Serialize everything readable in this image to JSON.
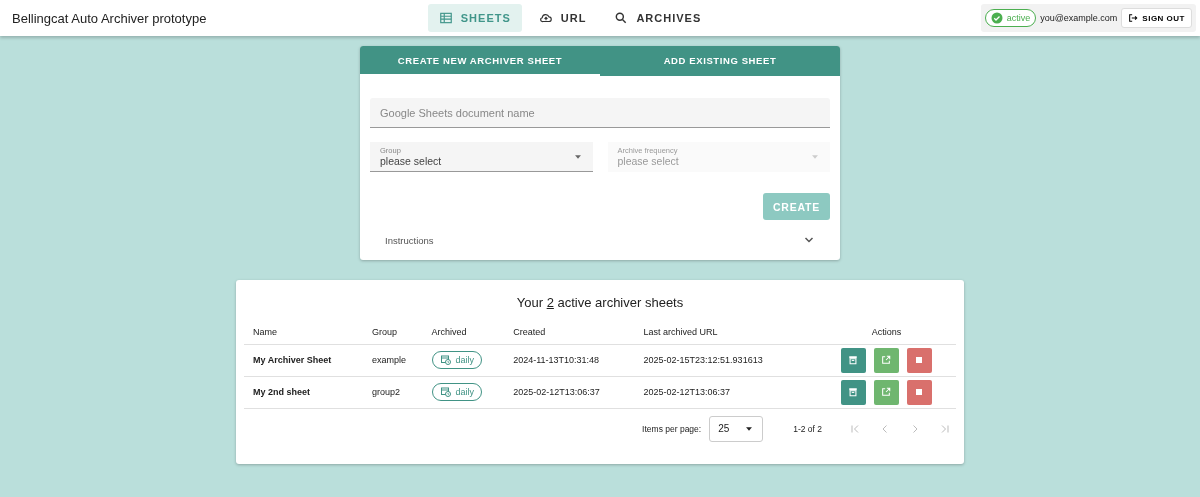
{
  "app_title": "Bellingcat Auto Archiver prototype",
  "nav": [
    {
      "label": "SHEETS",
      "kind": "table",
      "selected": true
    },
    {
      "label": "URL",
      "kind": "cloud",
      "selected": false
    },
    {
      "label": "ARCHIVES",
      "kind": "search",
      "selected": false
    }
  ],
  "user": {
    "status": "active",
    "email": "you@example.com",
    "sign_out": "SIGN OUT"
  },
  "form_tabs": [
    {
      "label": "CREATE NEW ARCHIVER SHEET",
      "selected": true
    },
    {
      "label": "ADD EXISTING SHEET",
      "selected": false
    }
  ],
  "name_field": {
    "placeholder": "Google Sheets document name"
  },
  "selects": [
    {
      "label": "Group",
      "value": "please select",
      "disabled": false
    },
    {
      "label": "Archive frequency",
      "value": "please select",
      "disabled": true
    }
  ],
  "create_button": {
    "label": "CREATE",
    "disabled": true
  },
  "instructions": {
    "label": "Instructions",
    "expanded": false
  },
  "table": {
    "title_before": "Your ",
    "count": "2",
    "title_after": " active archiver sheets",
    "columns": [
      "Name",
      "Group",
      "Archived",
      "Created",
      "Last archived URL",
      "Actions"
    ],
    "rows": [
      {
        "name": "My Archiver Sheet",
        "group": "example",
        "archived": "daily",
        "created": "2024-11-13T10:31:48",
        "last_url": "2025-02-15T23:12:51.931613"
      },
      {
        "name": "My 2nd sheet",
        "group": "group2",
        "archived": "daily",
        "created": "2025-02-12T13:06:37",
        "last_url": "2025-02-12T13:06:37"
      }
    ],
    "paginator": {
      "items_label": "Items per page:",
      "page_size": "25",
      "range": "1-2 of 2"
    }
  }
}
